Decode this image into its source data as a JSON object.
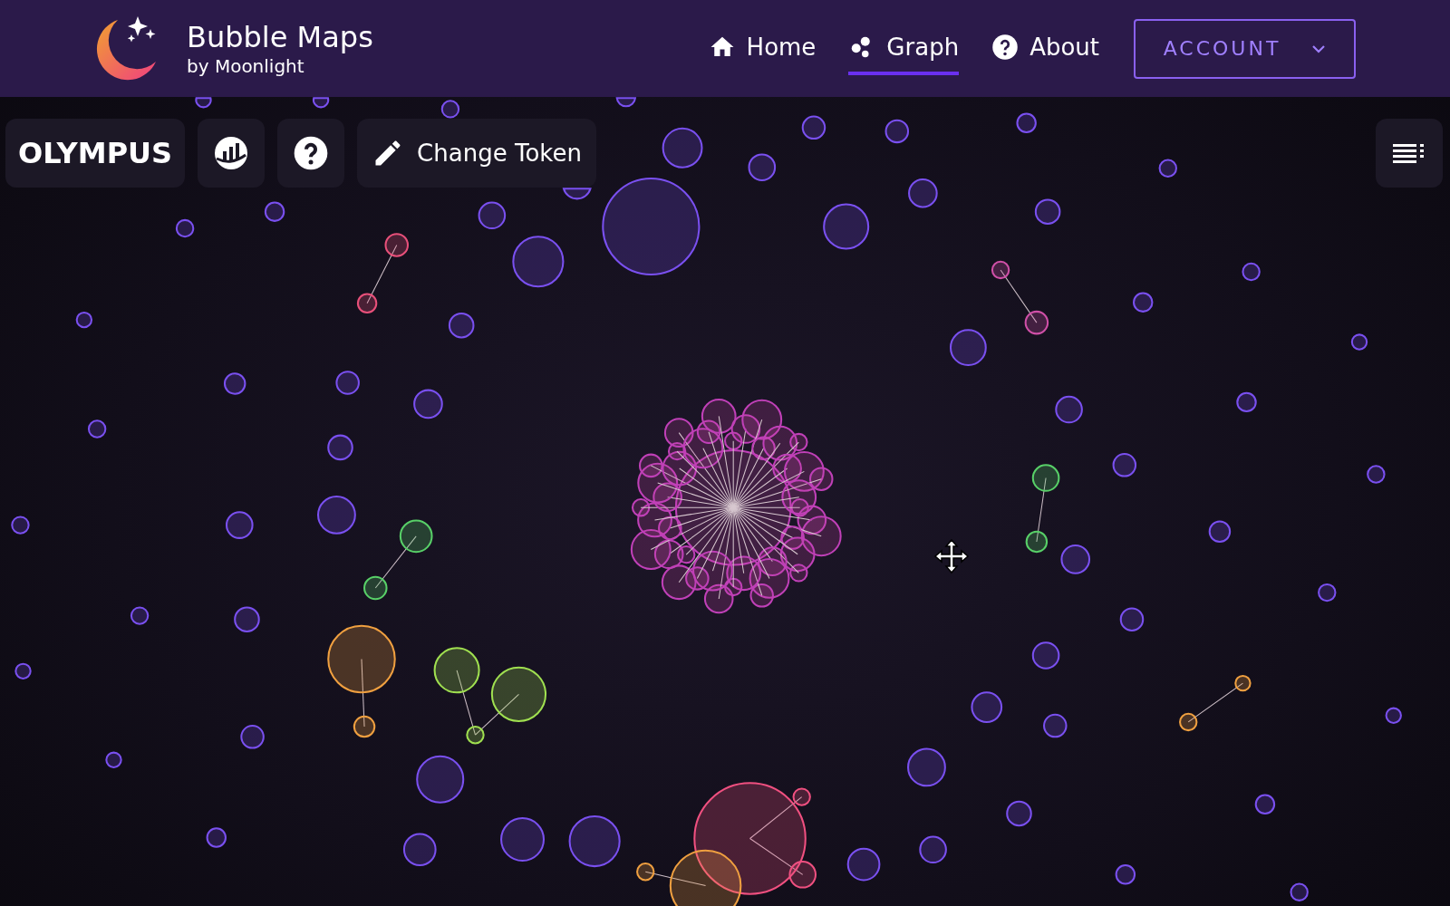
{
  "brand": {
    "title": "Bubble Maps",
    "subtitle": "by Moonlight"
  },
  "nav": [
    {
      "label": "Home",
      "selected": false
    },
    {
      "label": "Graph",
      "selected": true
    },
    {
      "label": "About",
      "selected": false
    }
  ],
  "account": {
    "label": "ACCOUNT"
  },
  "toolbar": {
    "token": "OLYMPUS",
    "change_token": "Change Token"
  }
}
